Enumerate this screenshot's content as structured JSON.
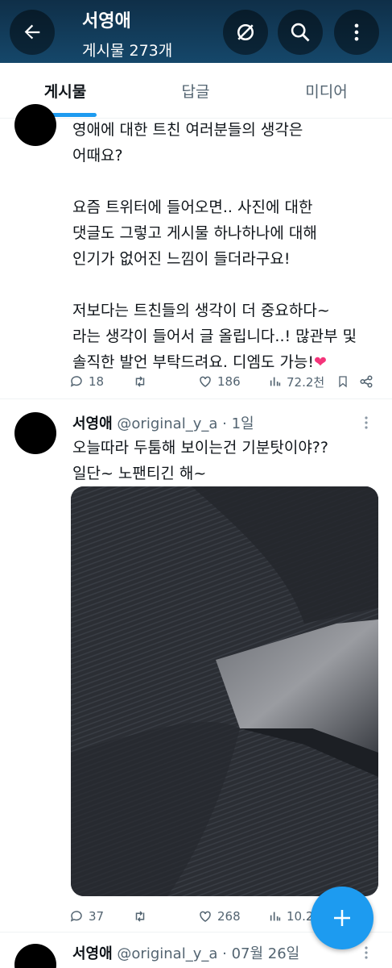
{
  "header": {
    "profile_name": "서영애",
    "post_count": "게시물 273개",
    "back_icon": "arrow-left-icon",
    "hide_icon": "eye-off-icon",
    "search_icon": "search-icon",
    "more_icon": "more-vertical-icon"
  },
  "tabs": [
    {
      "label": "게시물",
      "active": true
    },
    {
      "label": "답글",
      "active": false
    },
    {
      "label": "미디어",
      "active": false
    }
  ],
  "tweets": [
    {
      "text": "영애에 대한 트친 여러분들의 생각은\n어때요?\n\n요즘 트위터에 들어오면.. 사진에 대한\n댓글도 그렇고 게시물 하나하나에 대해\n인기가 없어진 느낌이 들더라구요!\n\n저보다는 트친들의 생각이 더 중요하다~\n라는 생각이 들어서 글 올립니다..! 많관부 및\n솔직한 발언 부탁드려요. 디엠도 가능!",
      "emoji": "❤",
      "replies": "18",
      "likes": "186",
      "views": "72.2천"
    },
    {
      "name": "서영애",
      "handle": "@original_y_a",
      "time": "· 1일",
      "text": "오늘따라 두툼해 보이는건 기분탓이야??\n일단~ 노팬티긴 해~",
      "replies": "37",
      "likes": "268",
      "views": "10.2"
    },
    {
      "name": "서영애",
      "handle": "@original_y_a",
      "time": "· 07월 26일"
    }
  ],
  "colors": {
    "header_bg": "#15476a",
    "accent": "#1d9bf0",
    "heart": "#f4347a"
  },
  "fab": {
    "icon": "plus-icon"
  }
}
